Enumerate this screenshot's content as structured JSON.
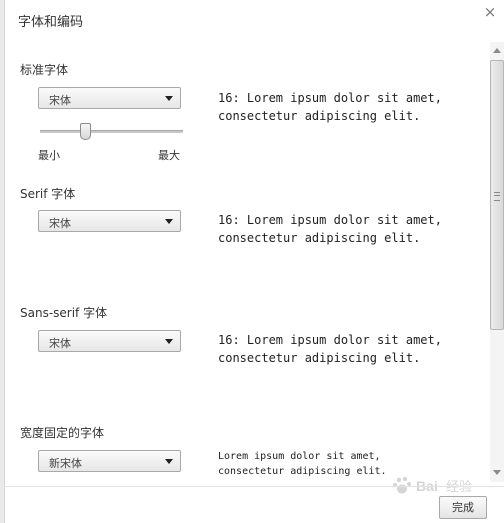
{
  "dialog": {
    "title": "字体和编码",
    "close_icon": "close-icon",
    "done_label": "完成"
  },
  "standard_font": {
    "label": "标准字体",
    "selected": "宋体",
    "preview": "16: Lorem ipsum dolor sit amet,\nconsectetur adipiscing elit.",
    "size_slider": {
      "min_label": "最小",
      "max_label": "最大",
      "value_fraction": 0.3
    }
  },
  "serif_font": {
    "label": "Serif 字体",
    "selected": "宋体",
    "preview": "16: Lorem ipsum dolor sit amet,\nconsectetur adipiscing elit."
  },
  "sans_serif_font": {
    "label": "Sans-serif 字体",
    "selected": "宋体",
    "preview": "16: Lorem ipsum dolor sit amet,\nconsectetur adipiscing elit."
  },
  "fixed_width_font": {
    "label": "宽度固定的字体",
    "selected": "新宋体",
    "preview": "Lorem ipsum dolor sit amet,\nconsectetur adipiscing elit."
  },
  "watermark": {
    "text": "Bai 经验"
  },
  "colors": {
    "background": "#ffffff",
    "border": "#a9a9a9",
    "text": "#333333"
  }
}
